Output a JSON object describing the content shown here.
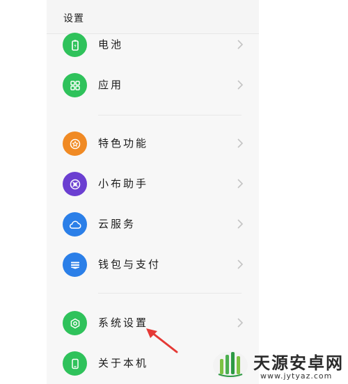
{
  "header": {
    "title": "设置"
  },
  "items": [
    {
      "label": "电池",
      "icon": "battery-icon",
      "color": "#2fc25b"
    },
    {
      "label": "应用",
      "icon": "apps-grid-icon",
      "color": "#2fc25b"
    },
    {
      "label": "特色功能",
      "icon": "star-icon",
      "color": "#f08a24"
    },
    {
      "label": "小布助手",
      "icon": "assistant-icon",
      "color": "#6b3fd1"
    },
    {
      "label": "云服务",
      "icon": "cloud-icon",
      "color": "#2b7fe8"
    },
    {
      "label": "钱包与支付",
      "icon": "wallet-icon",
      "color": "#2b7fe8"
    },
    {
      "label": "系统设置",
      "icon": "system-settings-icon",
      "color": "#2fc25b"
    },
    {
      "label": "关于本机",
      "icon": "phone-icon",
      "color": "#2fc25b"
    }
  ],
  "watermark": {
    "name": "天源安卓网",
    "url": "www.jytyaz.com"
  },
  "colors": {
    "accent_green": "#2fc25b",
    "accent_orange": "#f08a24",
    "accent_purple": "#6b3fd1",
    "accent_blue": "#2b7fe8",
    "arrow_red": "#e53935"
  }
}
